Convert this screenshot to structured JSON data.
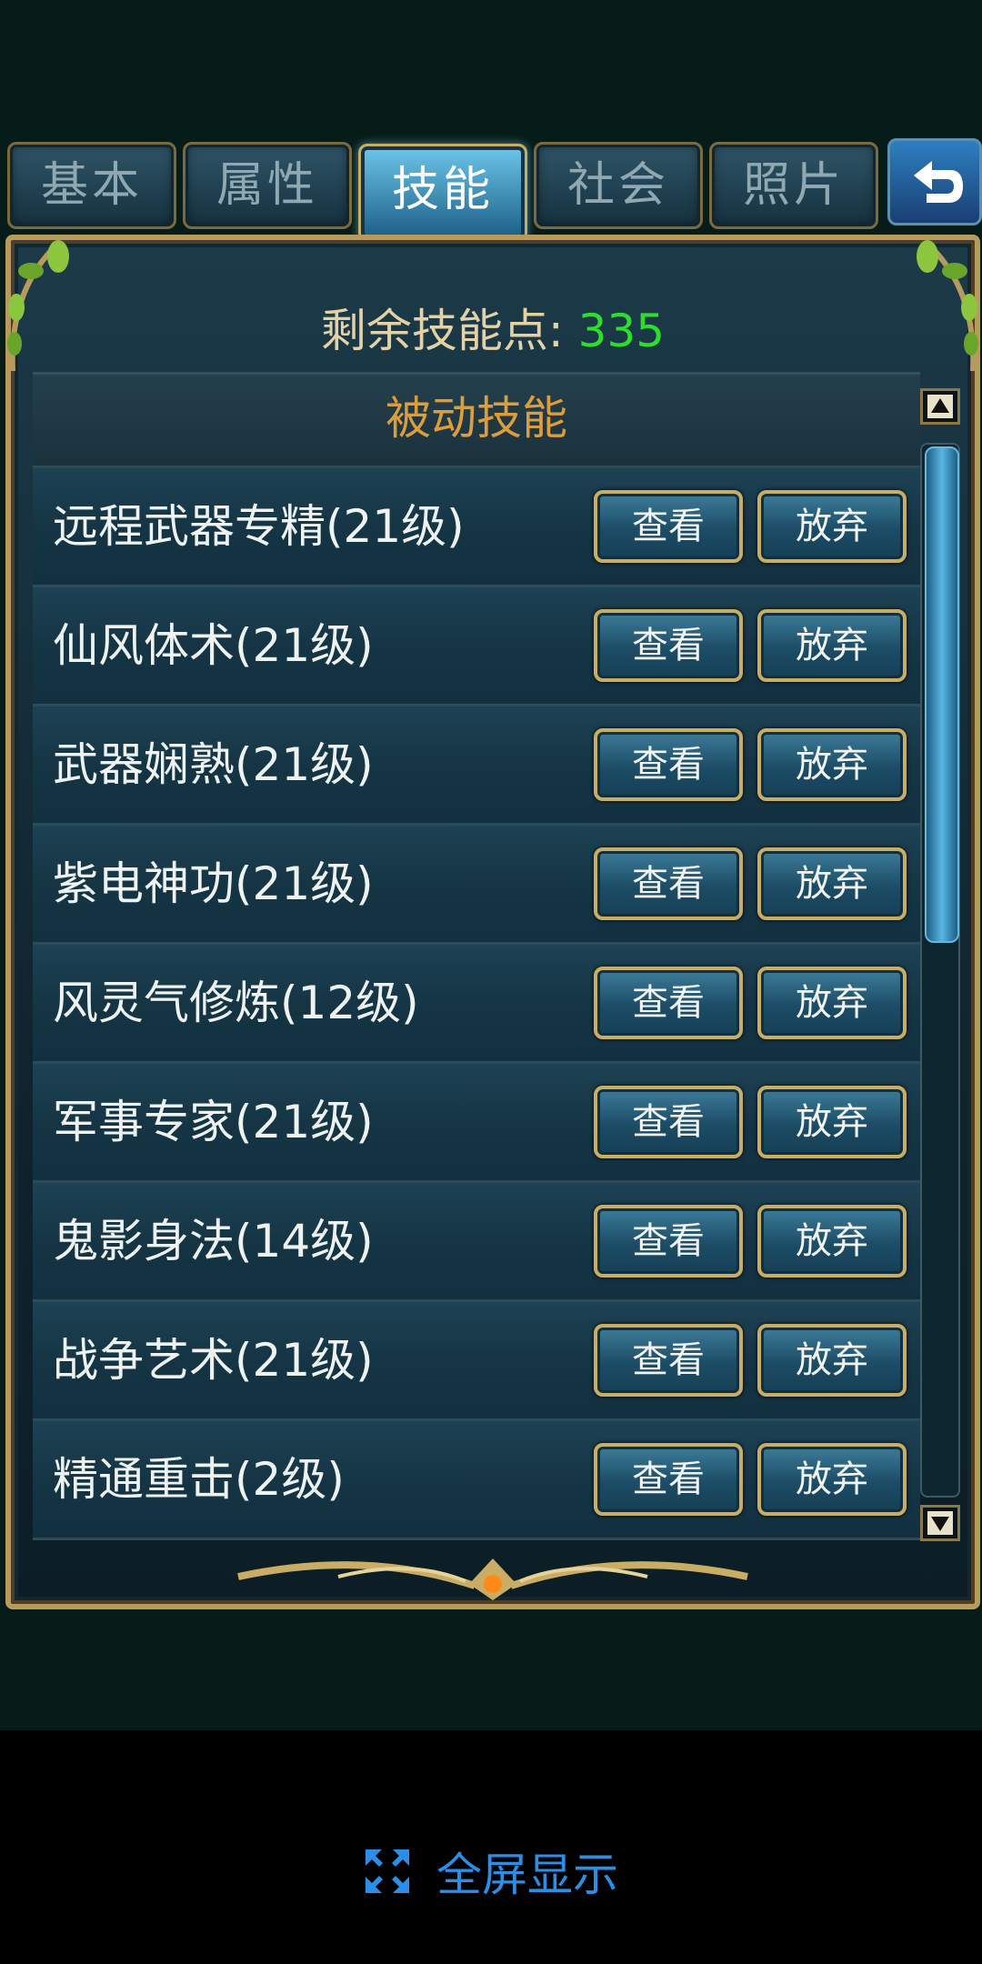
{
  "tabs": [
    {
      "label": "基本",
      "active": false
    },
    {
      "label": "属性",
      "active": false
    },
    {
      "label": "技能",
      "active": true
    },
    {
      "label": "社会",
      "active": false
    },
    {
      "label": "照片",
      "active": false
    }
  ],
  "back_icon": "back-arrow-icon",
  "skill_points": {
    "label": "剩余技能点:",
    "value": "335"
  },
  "list_header": "被动技能",
  "skills": [
    {
      "name": "远程武器专精(21级)",
      "view": "查看",
      "drop": "放弃"
    },
    {
      "name": "仙风体术(21级)",
      "view": "查看",
      "drop": "放弃"
    },
    {
      "name": "武器娴熟(21级)",
      "view": "查看",
      "drop": "放弃"
    },
    {
      "name": "紫电神功(21级)",
      "view": "查看",
      "drop": "放弃"
    },
    {
      "name": "风灵气修炼(12级)",
      "view": "查看",
      "drop": "放弃"
    },
    {
      "name": "军事专家(21级)",
      "view": "查看",
      "drop": "放弃"
    },
    {
      "name": "鬼影身法(14级)",
      "view": "查看",
      "drop": "放弃"
    },
    {
      "name": "战争艺术(21级)",
      "view": "查看",
      "drop": "放弃"
    },
    {
      "name": "精通重击(2级)",
      "view": "查看",
      "drop": "放弃"
    }
  ],
  "fullscreen": {
    "label": "全屏显示",
    "icon": "expand-icon"
  },
  "colors": {
    "accent_gold": "#c9ad64",
    "points_green": "#2dde2d",
    "header_orange": "#dd9d3a",
    "link_blue": "#2b8fe8"
  }
}
